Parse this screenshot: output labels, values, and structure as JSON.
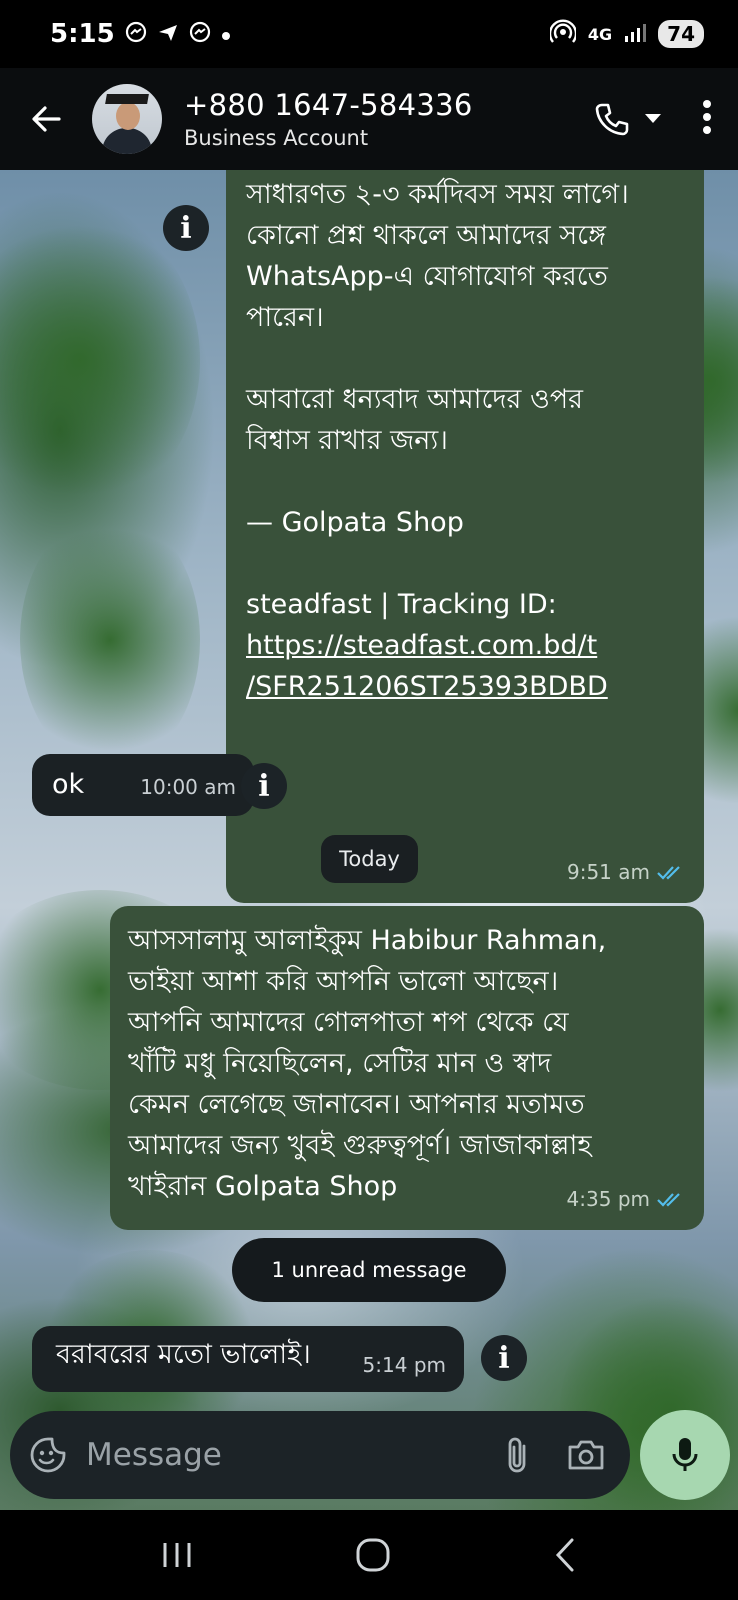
{
  "status_bar": {
    "time": "5:15",
    "network": "4G",
    "battery": "74",
    "icons": [
      "messenger-icon",
      "send-icon",
      "messenger-icon",
      "dot-icon",
      "hotspot-icon",
      "signal-icon"
    ]
  },
  "header": {
    "contact_name": "+880 1647-584336",
    "subtitle": "Business Account"
  },
  "messages": [
    {
      "direction": "outgoing",
      "lines": [
        "সাধারণত ২-৩ কর্মদিবস সময় লাগে।",
        "কোনো প্রশ্ন থাকলে আমাদের সঙ্গে",
        "WhatsApp-এ যোগাযোগ করতে",
        "পারেন।",
        "",
        "আবারো ধন্যবাদ আমাদের ওপর",
        "বিশ্বাস রাখার জন্য।",
        "",
        "— Golpata Shop",
        "",
        "steadfast | Tracking ID:"
      ],
      "link_lines": [
        "https://steadfast.com.bd/t",
        "/SFR251206ST25393BDBD"
      ],
      "time": "9:51 am",
      "status": "read"
    },
    {
      "direction": "incoming",
      "text": "ok",
      "time": "10:00 am"
    },
    {
      "direction": "outgoing",
      "lines": [
        "আসসালামু আলাইকুম Habibur Rahman,",
        "ভাইয়া আশা করি আপনি ভালো আছেন।",
        "আপনি আমাদের গোলপাতা শপ থেকে যে",
        "খাঁটি মধু নিয়েছিলেন, সেটির মান ও স্বাদ",
        "কেমন লেগেছে জানাবেন। আপনার মতামত",
        "আমাদের জন্য খুবই গুরুত্বপূর্ণ। জাজাকাল্লাহ",
        "খাইরান Golpata Shop"
      ],
      "time": "4:35 pm",
      "status": "read"
    },
    {
      "direction": "incoming",
      "text": "বরাবরের মতো ভালোই।",
      "time": "5:14 pm"
    }
  ],
  "date_separator": "Today",
  "unread_banner": "1 unread message",
  "composer": {
    "placeholder": "Message"
  },
  "colors": {
    "outgoing_bubble": "#39513a",
    "incoming_bubble": "#1b2124",
    "read_ticks": "#53bdeb",
    "mic_button": "#a7d7b0"
  }
}
